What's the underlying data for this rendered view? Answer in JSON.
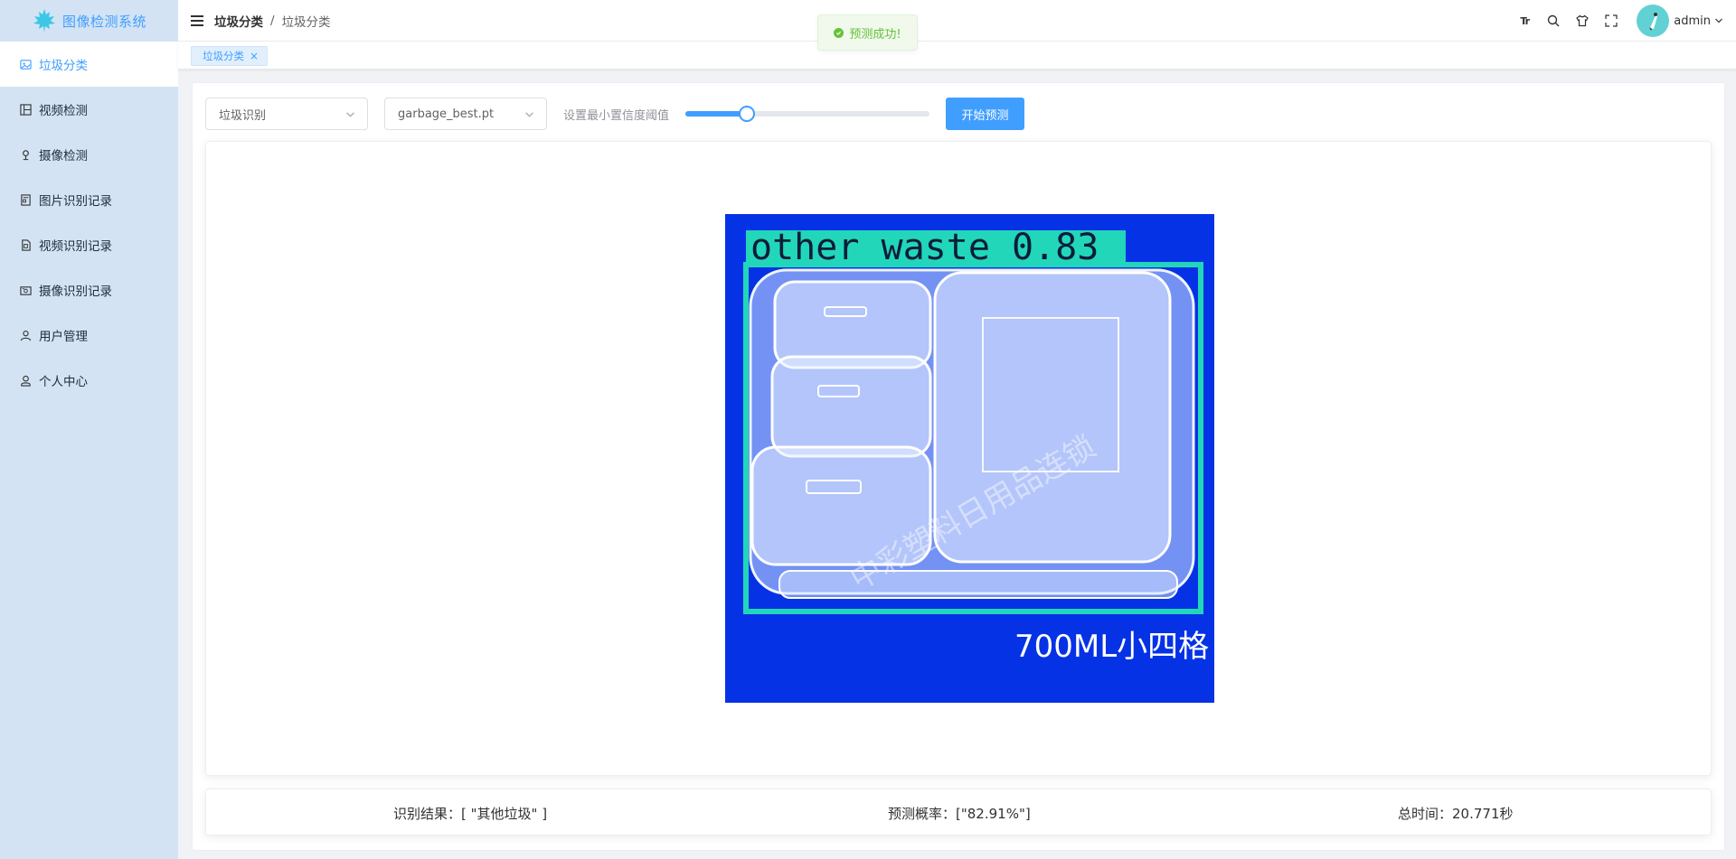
{
  "app": {
    "title": "图像检测系统"
  },
  "colors": {
    "accent": "#409eff",
    "sidebar_bg": "#d3e3f3",
    "success": "#67c23a",
    "detect_box": "#22d6b9",
    "image_bg": "#0632e6"
  },
  "sidebar": {
    "items": [
      {
        "label": "垃圾分类",
        "icon": "image-icon",
        "active": true
      },
      {
        "label": "视频检测",
        "icon": "grid-icon",
        "active": false
      },
      {
        "label": "摄像检测",
        "icon": "location-icon",
        "active": false
      },
      {
        "label": "图片识别记录",
        "icon": "document-icon",
        "active": false
      },
      {
        "label": "视频识别记录",
        "icon": "file-icon",
        "active": false
      },
      {
        "label": "摄像识别记录",
        "icon": "camera-icon",
        "active": false
      },
      {
        "label": "用户管理",
        "icon": "user-icon",
        "active": false
      },
      {
        "label": "个人中心",
        "icon": "person-icon",
        "active": false
      }
    ]
  },
  "header": {
    "breadcrumb": [
      "垃圾分类",
      "垃圾分类"
    ],
    "separator": "/",
    "user_name": "admin",
    "icons": [
      "font-size-icon",
      "search-icon",
      "shirt-icon",
      "fullscreen-icon"
    ],
    "font_size_glyph": "Tr"
  },
  "tags": [
    {
      "label": "垃圾分类",
      "close": "×"
    }
  ],
  "toast": {
    "message": "预测成功!"
  },
  "toolbar": {
    "task_select": "垃圾识别",
    "model_select": "garbage_best.pt",
    "slider_label": "设置最小置信度阈值",
    "slider_value": 0.25,
    "predict_label": "开始预测"
  },
  "result_image": {
    "detection_label": "other waste 0.83",
    "product_text": "700ML小四格",
    "watermark": "中彩塑料日用品连锁"
  },
  "results": {
    "recognition": "识别结果：[ \"其他垃圾\" ]",
    "probability": "预测概率：[\"82.91%\"]",
    "total_time": "总时间：20.771秒"
  }
}
